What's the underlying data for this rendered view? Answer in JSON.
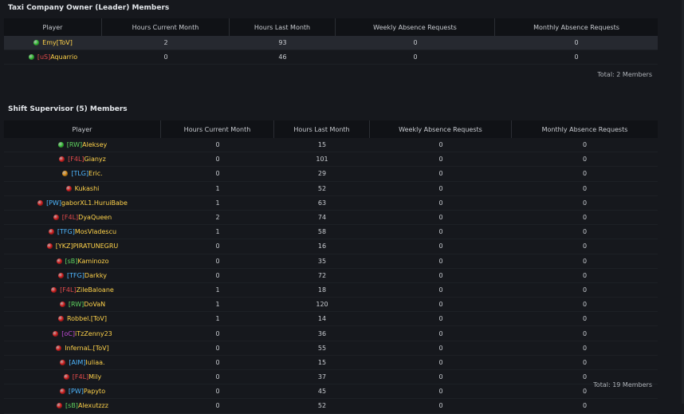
{
  "groups": [
    {
      "title": "Taxi Company Owner (Leader) Members",
      "columns": [
        "Player",
        "Hours Current Month",
        "Hours Last Month",
        "Weekly Absence Requests",
        "Monthly Absence Requests"
      ],
      "total": "Total: 2 Members",
      "rows": [
        {
          "status": "green",
          "tag": "",
          "tag_color": "",
          "name": "Emy[ToV]",
          "cur": "2",
          "last": "93",
          "weekly": "0",
          "monthly": "0",
          "highlight": true
        },
        {
          "status": "green",
          "tag": "[uS]",
          "tag_color": "#e24a4a",
          "name": "Aquarrio",
          "cur": "0",
          "last": "46",
          "weekly": "0",
          "monthly": "0",
          "highlight": false
        }
      ]
    },
    {
      "title": "Shift Supervisor (5) Members",
      "columns": [
        "Player",
        "Hours Current Month",
        "Hours Last Month",
        "Weekly Absence Requests",
        "Monthly Absence Requests"
      ],
      "total": "Total: 19 Members",
      "rows": [
        {
          "status": "green",
          "tag": "[RW]",
          "tag_color": "#5fd35f",
          "name": "Aleksey",
          "cur": "0",
          "last": "15",
          "weekly": "0",
          "monthly": "0"
        },
        {
          "status": "red",
          "tag": "[F4L]",
          "tag_color": "#e24a4a",
          "name": "Gianyz",
          "cur": "0",
          "last": "101",
          "weekly": "0",
          "monthly": "0"
        },
        {
          "status": "orange",
          "tag": "[TLG]",
          "tag_color": "#4fb7ff",
          "name": "Eric.",
          "cur": "0",
          "last": "29",
          "weekly": "0",
          "monthly": "0"
        },
        {
          "status": "red",
          "tag": "",
          "tag_color": "",
          "name": "Kukashi",
          "cur": "1",
          "last": "52",
          "weekly": "0",
          "monthly": "0"
        },
        {
          "status": "red",
          "tag": "[PW]",
          "tag_color": "#4fb7ff",
          "name": "gaborXL1.HuruiBabe",
          "cur": "1",
          "last": "63",
          "weekly": "0",
          "monthly": "0"
        },
        {
          "status": "red",
          "tag": "[F4L]",
          "tag_color": "#e24a4a",
          "name": "DyaQueen",
          "cur": "2",
          "last": "74",
          "weekly": "0",
          "monthly": "0"
        },
        {
          "status": "red",
          "tag": "[TFG]",
          "tag_color": "#4fb7ff",
          "name": "MosVladescu",
          "cur": "1",
          "last": "58",
          "weekly": "0",
          "monthly": "0"
        },
        {
          "status": "red",
          "tag": "[YKZ]",
          "tag_color": "#ffd24a",
          "name": "PIRATUNEGRU",
          "cur": "0",
          "last": "16",
          "weekly": "0",
          "monthly": "0"
        },
        {
          "status": "red",
          "tag": "[sB]",
          "tag_color": "#5fd35f",
          "name": "Kaminozo",
          "cur": "0",
          "last": "35",
          "weekly": "0",
          "monthly": "0"
        },
        {
          "status": "red",
          "tag": "[TFG]",
          "tag_color": "#4fb7ff",
          "name": "Darkky",
          "cur": "0",
          "last": "72",
          "weekly": "0",
          "monthly": "0"
        },
        {
          "status": "red",
          "tag": "[F4L]",
          "tag_color": "#e24a4a",
          "name": "ZileBaloane",
          "cur": "1",
          "last": "18",
          "weekly": "0",
          "monthly": "0"
        },
        {
          "status": "red",
          "tag": "[RW]",
          "tag_color": "#5fd35f",
          "name": "DoVaN",
          "cur": "1",
          "last": "120",
          "weekly": "0",
          "monthly": "0"
        },
        {
          "status": "red",
          "tag": "",
          "tag_color": "",
          "name": "Robbel.[ToV]",
          "cur": "1",
          "last": "14",
          "weekly": "0",
          "monthly": "0"
        },
        {
          "status": "red",
          "tag": "[oC]",
          "tag_color": "#c04ad6",
          "name": "iTzZenny23",
          "cur": "0",
          "last": "36",
          "weekly": "0",
          "monthly": "0"
        },
        {
          "status": "red",
          "tag": "",
          "tag_color": "",
          "name": "InfernaL.[ToV]",
          "cur": "0",
          "last": "55",
          "weekly": "0",
          "monthly": "0"
        },
        {
          "status": "red",
          "tag": "[AIM]",
          "tag_color": "#4fb7ff",
          "name": "Iuliaa.",
          "cur": "0",
          "last": "15",
          "weekly": "0",
          "monthly": "0"
        },
        {
          "status": "red",
          "tag": "[F4L]",
          "tag_color": "#e24a4a",
          "name": "Mily",
          "cur": "0",
          "last": "37",
          "weekly": "0",
          "monthly": "0"
        },
        {
          "status": "red",
          "tag": "[PW]",
          "tag_color": "#4fb7ff",
          "name": "Papyto",
          "cur": "0",
          "last": "45",
          "weekly": "0",
          "monthly": "0"
        },
        {
          "status": "red",
          "tag": "[sB]",
          "tag_color": "#5fd35f",
          "name": "Alexutzzz",
          "cur": "0",
          "last": "52",
          "weekly": "0",
          "monthly": "0"
        }
      ]
    }
  ],
  "status_colors": {
    "green": "#3cc63c",
    "red": "#d92424",
    "orange": "#e0931c"
  },
  "name_color": "#ffd24a"
}
